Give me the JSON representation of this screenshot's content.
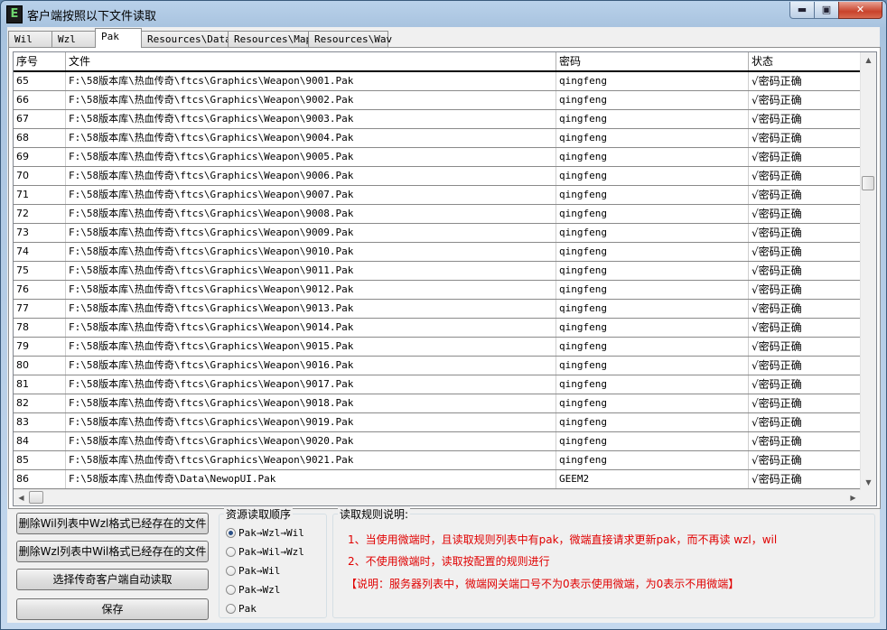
{
  "window": {
    "title": "客户端按照以下文件读取",
    "icon_letter": "E",
    "min": "▬",
    "max": "▣",
    "close": "✕"
  },
  "tabs": [
    "Wil",
    "Wzl",
    "Pak",
    "Resources\\Data",
    "Resources\\Map",
    "Resources\\Wav"
  ],
  "active_tab": "Pak",
  "columns": [
    "序号",
    "文件",
    "密码",
    "状态"
  ],
  "rows": [
    {
      "no": "65",
      "file": "F:\\58版本库\\热血传奇\\ftcs\\Graphics\\Weapon\\9001.Pak",
      "pw": "qingfeng",
      "st": "√密码正确"
    },
    {
      "no": "66",
      "file": "F:\\58版本库\\热血传奇\\ftcs\\Graphics\\Weapon\\9002.Pak",
      "pw": "qingfeng",
      "st": "√密码正确"
    },
    {
      "no": "67",
      "file": "F:\\58版本库\\热血传奇\\ftcs\\Graphics\\Weapon\\9003.Pak",
      "pw": "qingfeng",
      "st": "√密码正确"
    },
    {
      "no": "68",
      "file": "F:\\58版本库\\热血传奇\\ftcs\\Graphics\\Weapon\\9004.Pak",
      "pw": "qingfeng",
      "st": "√密码正确"
    },
    {
      "no": "69",
      "file": "F:\\58版本库\\热血传奇\\ftcs\\Graphics\\Weapon\\9005.Pak",
      "pw": "qingfeng",
      "st": "√密码正确"
    },
    {
      "no": "70",
      "file": "F:\\58版本库\\热血传奇\\ftcs\\Graphics\\Weapon\\9006.Pak",
      "pw": "qingfeng",
      "st": "√密码正确"
    },
    {
      "no": "71",
      "file": "F:\\58版本库\\热血传奇\\ftcs\\Graphics\\Weapon\\9007.Pak",
      "pw": "qingfeng",
      "st": "√密码正确"
    },
    {
      "no": "72",
      "file": "F:\\58版本库\\热血传奇\\ftcs\\Graphics\\Weapon\\9008.Pak",
      "pw": "qingfeng",
      "st": "√密码正确"
    },
    {
      "no": "73",
      "file": "F:\\58版本库\\热血传奇\\ftcs\\Graphics\\Weapon\\9009.Pak",
      "pw": "qingfeng",
      "st": "√密码正确"
    },
    {
      "no": "74",
      "file": "F:\\58版本库\\热血传奇\\ftcs\\Graphics\\Weapon\\9010.Pak",
      "pw": "qingfeng",
      "st": "√密码正确"
    },
    {
      "no": "75",
      "file": "F:\\58版本库\\热血传奇\\ftcs\\Graphics\\Weapon\\9011.Pak",
      "pw": "qingfeng",
      "st": "√密码正确"
    },
    {
      "no": "76",
      "file": "F:\\58版本库\\热血传奇\\ftcs\\Graphics\\Weapon\\9012.Pak",
      "pw": "qingfeng",
      "st": "√密码正确"
    },
    {
      "no": "77",
      "file": "F:\\58版本库\\热血传奇\\ftcs\\Graphics\\Weapon\\9013.Pak",
      "pw": "qingfeng",
      "st": "√密码正确"
    },
    {
      "no": "78",
      "file": "F:\\58版本库\\热血传奇\\ftcs\\Graphics\\Weapon\\9014.Pak",
      "pw": "qingfeng",
      "st": "√密码正确"
    },
    {
      "no": "79",
      "file": "F:\\58版本库\\热血传奇\\ftcs\\Graphics\\Weapon\\9015.Pak",
      "pw": "qingfeng",
      "st": "√密码正确"
    },
    {
      "no": "80",
      "file": "F:\\58版本库\\热血传奇\\ftcs\\Graphics\\Weapon\\9016.Pak",
      "pw": "qingfeng",
      "st": "√密码正确"
    },
    {
      "no": "81",
      "file": "F:\\58版本库\\热血传奇\\ftcs\\Graphics\\Weapon\\9017.Pak",
      "pw": "qingfeng",
      "st": "√密码正确"
    },
    {
      "no": "82",
      "file": "F:\\58版本库\\热血传奇\\ftcs\\Graphics\\Weapon\\9018.Pak",
      "pw": "qingfeng",
      "st": "√密码正确"
    },
    {
      "no": "83",
      "file": "F:\\58版本库\\热血传奇\\ftcs\\Graphics\\Weapon\\9019.Pak",
      "pw": "qingfeng",
      "st": "√密码正确"
    },
    {
      "no": "84",
      "file": "F:\\58版本库\\热血传奇\\ftcs\\Graphics\\Weapon\\9020.Pak",
      "pw": "qingfeng",
      "st": "√密码正确"
    },
    {
      "no": "85",
      "file": "F:\\58版本库\\热血传奇\\ftcs\\Graphics\\Weapon\\9021.Pak",
      "pw": "qingfeng",
      "st": "√密码正确"
    },
    {
      "no": "86",
      "file": "F:\\58版本库\\热血传奇\\Data\\NewopUI.Pak",
      "pw": "GEEM2",
      "st": "√密码正确"
    }
  ],
  "buttons": {
    "delete_wil": "删除Wil列表中Wzl格式已经存在的文件",
    "delete_wzl": "删除Wzl列表中Wil格式已经存在的文件",
    "auto_read": "选择传奇客户端自动读取",
    "save": "保存"
  },
  "order_group": {
    "title": "资源读取顺序",
    "options": [
      "Pak→Wzl→Wil",
      "Pak→Wil→Wzl",
      "Pak→Wil",
      "Pak→Wzl",
      "Pak"
    ],
    "selected": "Pak→Wzl→Wil"
  },
  "rules_group": {
    "title": "读取规则说明:",
    "lines": [
      "1、当使用微端时，且读取规则列表中有pak，微端直接请求更新pak，而不再读 wzl，wil",
      "2、不使用微端时，读取按配置的规则进行",
      "【说明：服务器列表中，微端网关端口号不为0表示使用微端，为0表示不用微端】"
    ],
    "color": "#e00000"
  }
}
